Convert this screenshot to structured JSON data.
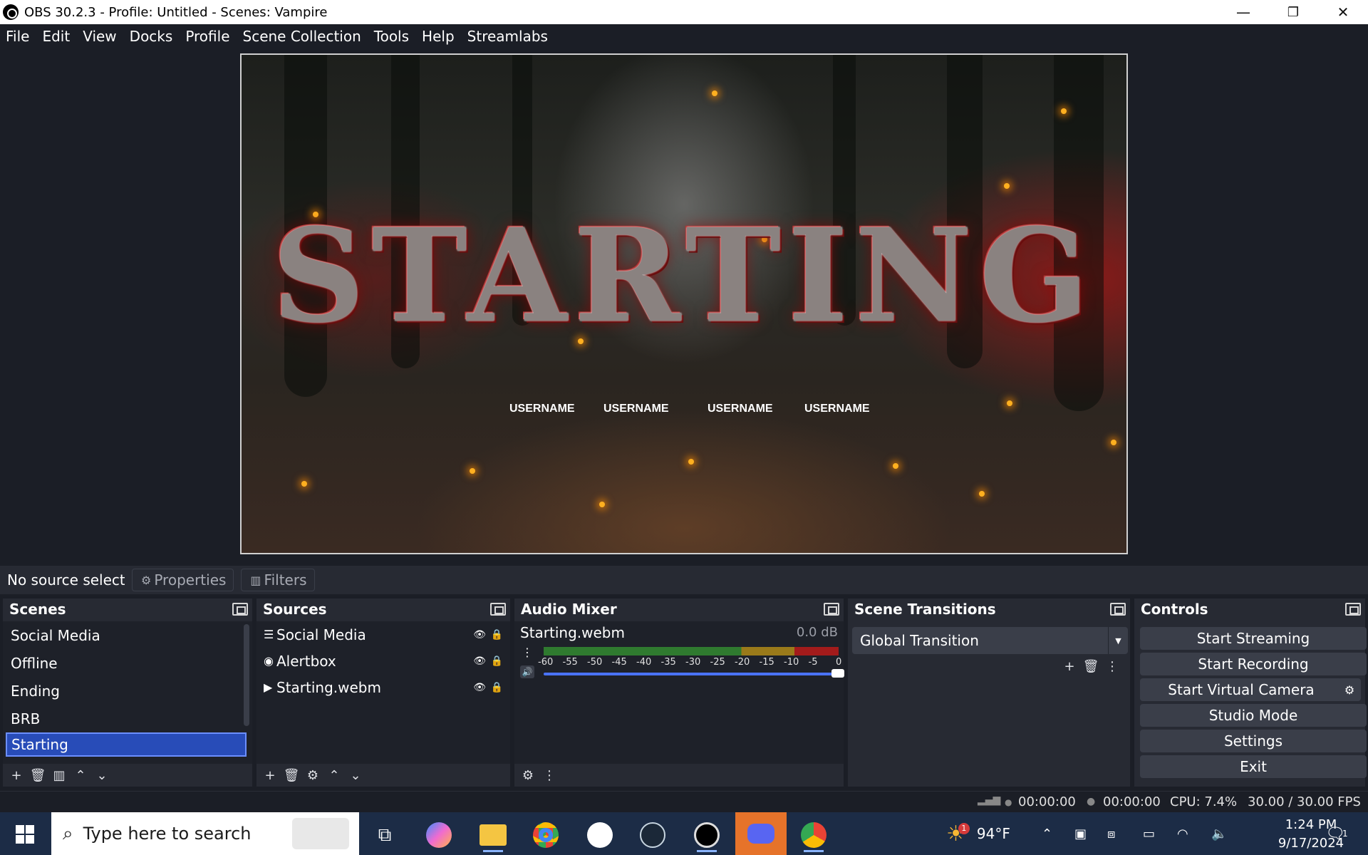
{
  "window": {
    "title": "OBS 30.2.3 - Profile: Untitled - Scenes: Vampire",
    "minimize": "—",
    "maximize": "❐",
    "close": "✕"
  },
  "menu": [
    "File",
    "Edit",
    "View",
    "Docks",
    "Profile",
    "Scene Collection",
    "Tools",
    "Help",
    "Streamlabs"
  ],
  "preview": {
    "title_text": "STARTING",
    "usernames": [
      "USERNAME",
      "USERNAME",
      "USERNAME",
      "USERNAME"
    ]
  },
  "source_bar": {
    "status": "No source selected",
    "properties": "Properties",
    "filters": "Filters"
  },
  "scenes": {
    "header": "Scenes",
    "items": [
      "Social Media",
      "Offline",
      "Ending",
      "BRB",
      "Starting"
    ],
    "selected": "Starting"
  },
  "sources": {
    "header": "Sources",
    "items": [
      {
        "name": "Social Media",
        "icon": "list-icon",
        "visible": true,
        "locked": false
      },
      {
        "name": "Alertbox",
        "icon": "globe-icon",
        "visible": true,
        "locked": false
      },
      {
        "name": "Starting.webm",
        "icon": "play-icon",
        "visible": true,
        "locked": false
      }
    ]
  },
  "audio_mixer": {
    "header": "Audio Mixer",
    "channel": {
      "name": "Starting.webm",
      "db": "0.0 dB",
      "ticks": [
        "-60",
        "-55",
        "-50",
        "-45",
        "-40",
        "-35",
        "-30",
        "-25",
        "-20",
        "-15",
        "-10",
        "-5",
        "0"
      ],
      "volume_fraction": 1.0
    }
  },
  "scene_transitions": {
    "header": "Scene Transitions",
    "selected": "Global Transition"
  },
  "controls": {
    "header": "Controls",
    "start_streaming": "Start Streaming",
    "start_recording": "Start Recording",
    "start_virtual_camera": "Start Virtual Camera",
    "studio_mode": "Studio Mode",
    "settings": "Settings",
    "exit": "Exit"
  },
  "status": {
    "stream_time": "00:00:00",
    "rec_time": "00:00:00",
    "cpu": "CPU: 7.4%",
    "fps": "30.00 / 30.00 FPS"
  },
  "taskbar": {
    "search_placeholder": "Type here to search",
    "weather_temp": "94°F",
    "weather_badge": "1",
    "time": "1:24 PM",
    "date": "9/17/2024",
    "notification_count": "1"
  },
  "colors": {
    "accent": "#284cb8",
    "panel": "#272a33",
    "background": "#1b1e26",
    "taskbar": "#1c2c46"
  }
}
